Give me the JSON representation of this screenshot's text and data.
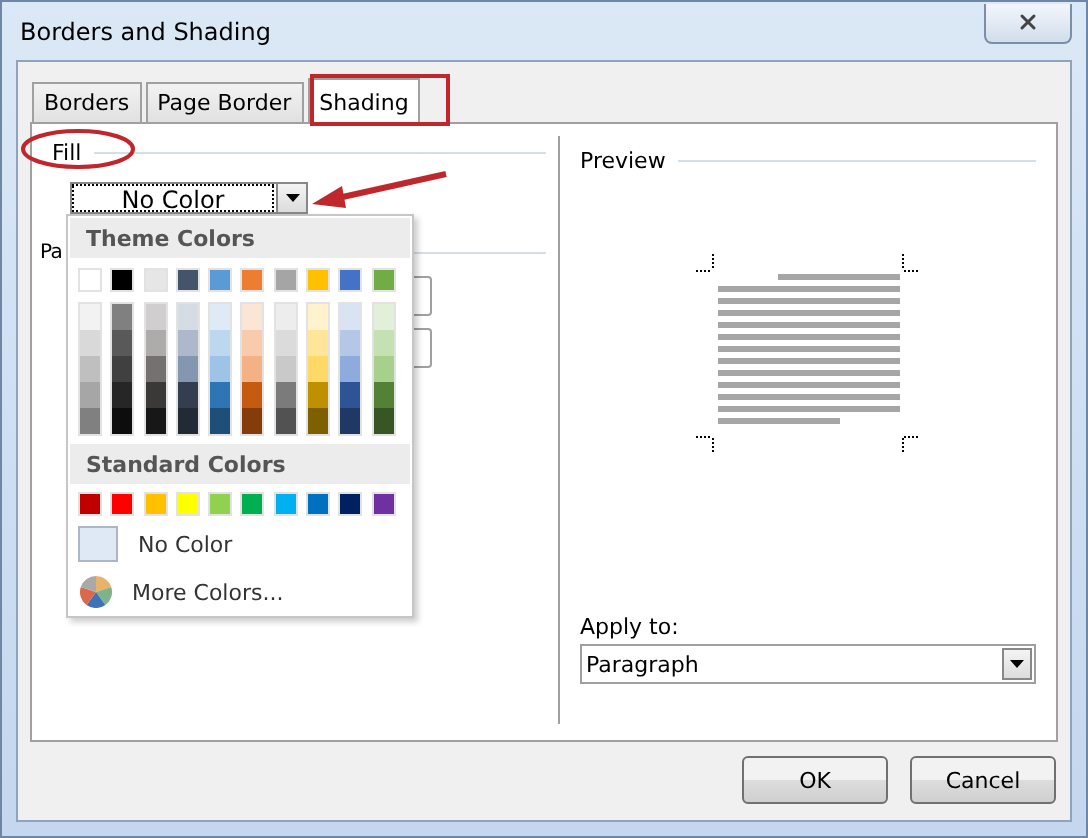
{
  "window": {
    "title": "Borders and Shading"
  },
  "tabs": [
    {
      "label": "Borders",
      "selected": false
    },
    {
      "label": "Page Border",
      "selected": false
    },
    {
      "label": "Shading",
      "selected": true
    }
  ],
  "fill": {
    "label": "Fill",
    "value": "No Color"
  },
  "patterns": {
    "label": "Pa"
  },
  "color_menu": {
    "theme_header": "Theme Colors",
    "theme_colors": [
      {
        "color": "#ffffff",
        "shades": [
          {
            "color": "#f2f2f2"
          },
          {
            "color": "#d9d9d9"
          },
          {
            "color": "#bfbfbf"
          },
          {
            "color": "#a6a6a6"
          },
          {
            "color": "#808080"
          }
        ]
      },
      {
        "color": "#000000",
        "shades": [
          {
            "color": "#808080"
          },
          {
            "color": "#595959"
          },
          {
            "color": "#404040"
          },
          {
            "color": "#262626"
          },
          {
            "color": "#0d0d0d"
          }
        ]
      },
      {
        "color": "#e7e6e6",
        "shades": [
          {
            "color": "#d0cece"
          },
          {
            "color": "#aeabab"
          },
          {
            "color": "#757171"
          },
          {
            "color": "#3b3838"
          },
          {
            "color": "#181717"
          }
        ]
      },
      {
        "color": "#44546a",
        "shades": [
          {
            "color": "#d6dce4"
          },
          {
            "color": "#adb9ca"
          },
          {
            "color": "#8497b0"
          },
          {
            "color": "#333f4f"
          },
          {
            "color": "#222a35"
          }
        ]
      },
      {
        "color": "#5b9bd5",
        "shades": [
          {
            "color": "#deebf6"
          },
          {
            "color": "#bdd7ee"
          },
          {
            "color": "#9dc3e6"
          },
          {
            "color": "#2e75b5"
          },
          {
            "color": "#1f4e79"
          }
        ]
      },
      {
        "color": "#ed7d31",
        "shades": [
          {
            "color": "#fbe5d5"
          },
          {
            "color": "#f7cbac"
          },
          {
            "color": "#f4b183"
          },
          {
            "color": "#c55a11"
          },
          {
            "color": "#843c0b"
          }
        ]
      },
      {
        "color": "#a5a5a5",
        "shades": [
          {
            "color": "#ededed"
          },
          {
            "color": "#dbdbdb"
          },
          {
            "color": "#c9c9c9"
          },
          {
            "color": "#7b7b7b"
          },
          {
            "color": "#525252"
          }
        ]
      },
      {
        "color": "#ffc000",
        "shades": [
          {
            "color": "#fff2cc"
          },
          {
            "color": "#fee599"
          },
          {
            "color": "#ffd965"
          },
          {
            "color": "#bf9000"
          },
          {
            "color": "#7f6000"
          }
        ]
      },
      {
        "color": "#4472c4",
        "shades": [
          {
            "color": "#dae3f3"
          },
          {
            "color": "#b4c7e7"
          },
          {
            "color": "#8faadc"
          },
          {
            "color": "#2f5496"
          },
          {
            "color": "#1f3864"
          }
        ]
      },
      {
        "color": "#70ad47",
        "shades": [
          {
            "color": "#e2efd9"
          },
          {
            "color": "#c5e0b3"
          },
          {
            "color": "#a8d08d"
          },
          {
            "color": "#538135"
          },
          {
            "color": "#375623"
          }
        ]
      }
    ],
    "standard_header": "Standard Colors",
    "standard_colors": [
      {
        "color": "#c00000"
      },
      {
        "color": "#ff0000"
      },
      {
        "color": "#ffc000"
      },
      {
        "color": "#ffff00"
      },
      {
        "color": "#92d050"
      },
      {
        "color": "#00b050"
      },
      {
        "color": "#00b0f0"
      },
      {
        "color": "#0070c0"
      },
      {
        "color": "#002060"
      },
      {
        "color": "#7030a0"
      }
    ],
    "no_color": "No Color",
    "more_colors": "More Colors..."
  },
  "preview": {
    "label": "Preview",
    "apply_to_label": "Apply to:",
    "apply_to_value": "Paragraph"
  },
  "buttons": [
    {
      "label": "OK"
    },
    {
      "label": "Cancel"
    }
  ],
  "annotations": [
    {
      "kind": "ellipse"
    },
    {
      "kind": "frame"
    },
    {
      "kind": "arrow"
    }
  ]
}
